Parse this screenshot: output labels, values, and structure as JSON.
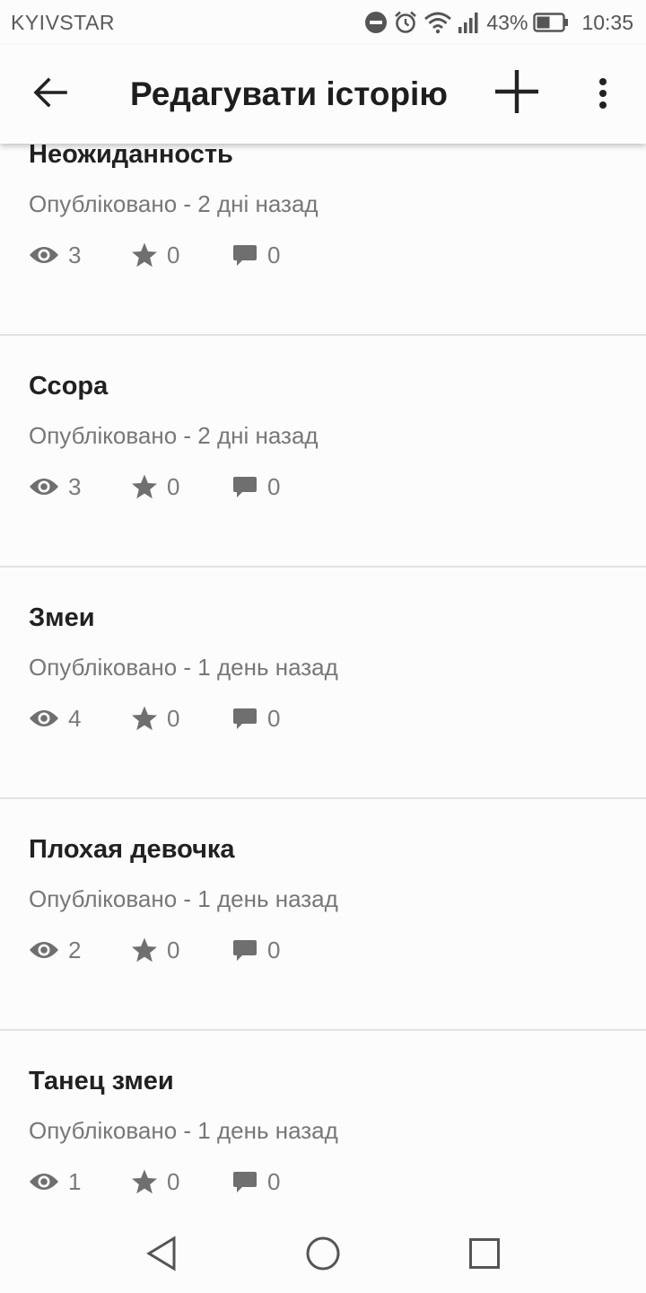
{
  "status_bar": {
    "carrier": "KYIVSTAR",
    "battery_percent": "43%",
    "time": "10:35",
    "icons": [
      "dnd-icon",
      "alarm-icon",
      "wifi-icon",
      "signal-icon",
      "battery-icon"
    ]
  },
  "toolbar": {
    "title": "Редагувати історію",
    "back_icon": "arrow-back-icon",
    "add_icon": "plus-icon",
    "more_icon": "more-vert-icon"
  },
  "stories": [
    {
      "title": "Неожиданность",
      "published": "Опубліковано - 2 дні назад",
      "views": "3",
      "stars": "0",
      "comments": "0"
    },
    {
      "title": "Ссора",
      "published": "Опубліковано - 2 дні назад",
      "views": "3",
      "stars": "0",
      "comments": "0"
    },
    {
      "title": "Змеи",
      "published": "Опубліковано - 1 день назад",
      "views": "4",
      "stars": "0",
      "comments": "0"
    },
    {
      "title": "Плохая девочка",
      "published": "Опубліковано - 1 день назад",
      "views": "2",
      "stars": "0",
      "comments": "0"
    },
    {
      "title": "Танец змеи",
      "published": "Опубліковано - 1 день назад",
      "views": "1",
      "stars": "0",
      "comments": "0"
    }
  ],
  "nav_bar": {
    "icons": [
      "nav-back-icon",
      "nav-home-icon",
      "nav-recents-icon"
    ]
  },
  "colors": {
    "background": "#fcfcfc",
    "title_text": "#212121",
    "meta_text": "#777777",
    "icon_gray": "#6f6f6f",
    "divider": "#e2e2e2"
  }
}
